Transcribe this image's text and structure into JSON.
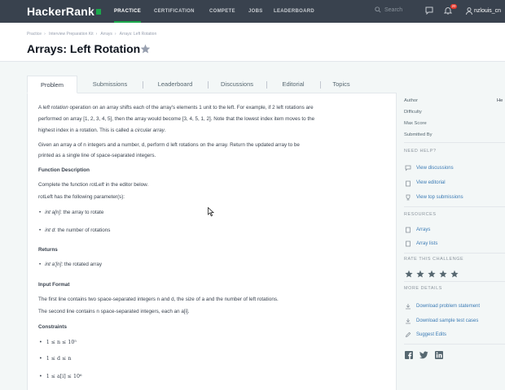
{
  "nav": {
    "logo": "HackerRank",
    "items": [
      "PRACTICE",
      "CERTIFICATION",
      "COMPETE",
      "JOBS",
      "LEADERBOARD"
    ],
    "search_placeholder": "Search",
    "notification_count": "20",
    "username": "nzlouis_cn"
  },
  "breadcrumb": [
    "Practice",
    "Interview Preparation Kit",
    "Arrays",
    "Arrays: Left Rotation"
  ],
  "page_title": "Arrays: Left Rotation",
  "tabs": [
    "Problem",
    "Submissions",
    "Leaderboard",
    "Discussions",
    "Editorial",
    "Topics"
  ],
  "problem": {
    "intro1a": "A ",
    "intro1b": "left rotation",
    "intro1c": " operation on an array shifts each of the array's elements 1 unit to the left. For example, if 2 left rotations are",
    "intro2": "performed on array [1, 2, 3, 4, 5], then the array would become [3, 4, 5, 1, 2]. Note that the lowest index item moves to the",
    "intro3a": "highest index in a rotation. This is called a ",
    "intro3b": "circular array",
    "intro3c": ".",
    "given1": "Given an array a of n integers and a number, d, perform d left rotations on the array. Return the updated array to be",
    "given2": "printed as a single line of space-separated integers.",
    "fd_heading": "Function Description",
    "fd1a": "Complete the function ",
    "fd1b": "rotLeft",
    "fd1c": " in the editor below.",
    "fd2": "rotLeft has the following parameter(s):",
    "param1a": "int a[n]",
    "param1b": ": the array to rotate",
    "param2a": "int d",
    "param2b": ": the number of rotations",
    "returns_heading": "Returns",
    "ret1a": "int a'[n]",
    "ret1b": ": the rotated array",
    "input_heading": "Input Format",
    "input1": "The first line contains two space-separated integers n and d, the size of a and the number of left rotations.",
    "input2": "The second line contains n space-separated integers, each an a[i].",
    "constraints_heading": "Constraints",
    "c1": "1 ≤ n ≤ 10⁵",
    "c2": "1 ≤ d ≤ n",
    "c3": "1 ≤ a[i] ≤ 10⁶"
  },
  "sidebar": {
    "meta": [
      {
        "label": "Author",
        "value": "He"
      },
      {
        "label": "Difficulty",
        "value": ""
      },
      {
        "label": "Max Score",
        "value": ""
      },
      {
        "label": "Submitted By",
        "value": ""
      }
    ],
    "need_help_heading": "NEED HELP?",
    "help_links": [
      "View discussions",
      "View editorial",
      "View top submissions"
    ],
    "resources_heading": "RESOURCES",
    "resources": [
      "Arrays",
      "Array lists"
    ],
    "rate_heading": "RATE THIS CHALLENGE",
    "rating_stars": 5,
    "more_heading": "MORE DETAILS",
    "more_links": [
      "Download problem statement",
      "Download sample test cases",
      "Suggest Edits"
    ]
  },
  "colors": {
    "nav_bg": "#39424e",
    "accent_green": "#1ba94c",
    "link_blue": "#3b7bb5",
    "badge_red": "#e5362a"
  }
}
